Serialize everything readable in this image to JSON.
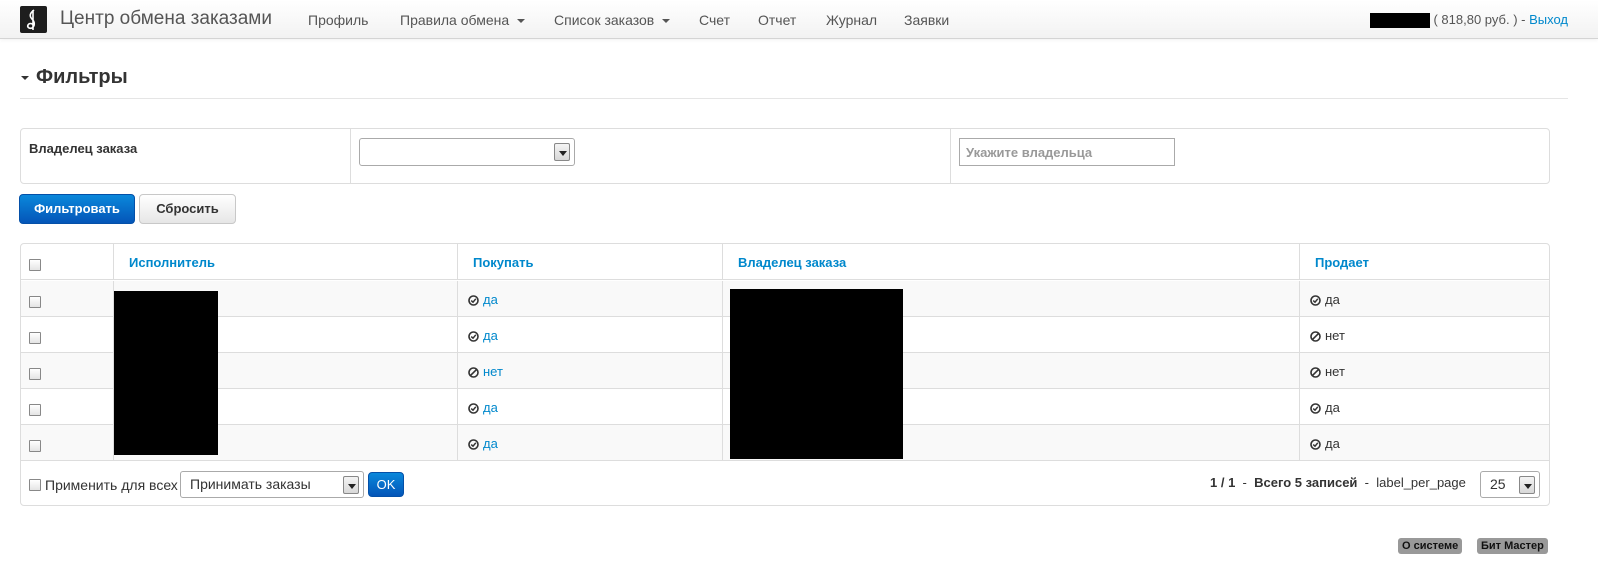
{
  "navbar": {
    "brand": "Центр обмена заказами",
    "items": [
      {
        "label": "Профиль"
      },
      {
        "label": "Правила обмена"
      },
      {
        "label": "Список заказов"
      },
      {
        "label": "Счет"
      },
      {
        "label": "Отчет"
      },
      {
        "label": "Журнал"
      },
      {
        "label": "Заявки"
      }
    ],
    "balance": "( 818,80 руб. ) -",
    "logout": "Выход"
  },
  "filters": {
    "title": "Фильтры",
    "owner_label": "Владелец заказа",
    "owner_select_value": "",
    "owner_input_placeholder": "Укажите владельца",
    "filter_button": "Фильтровать",
    "reset_button": "Сбросить"
  },
  "table": {
    "headers": {
      "executor": "Исполнитель",
      "buy": "Покупать",
      "owner": "Владелец заказа",
      "sells": "Продает"
    },
    "rows": [
      {
        "buy": "да",
        "sells": "да"
      },
      {
        "buy": "да",
        "sells": "нет"
      },
      {
        "buy": "нет",
        "sells": "нет"
      },
      {
        "buy": "да",
        "sells": "да"
      },
      {
        "buy": "да",
        "sells": "да"
      }
    ],
    "footer": {
      "apply_all_label": "Применить для всех",
      "action_select_value": "Принимать заказы",
      "ok_button": "OK",
      "page_info": "1 / 1",
      "separator": "-",
      "total_records": "Всего 5 записей",
      "per_page_label": "label_per_page",
      "per_page_value": "25"
    }
  },
  "footer_badges": {
    "about": "О системе",
    "vendor": "Бит Мастер"
  },
  "colors": {
    "link": "#0088cc",
    "primary_button": "#0455b8",
    "badge": "#999999"
  }
}
